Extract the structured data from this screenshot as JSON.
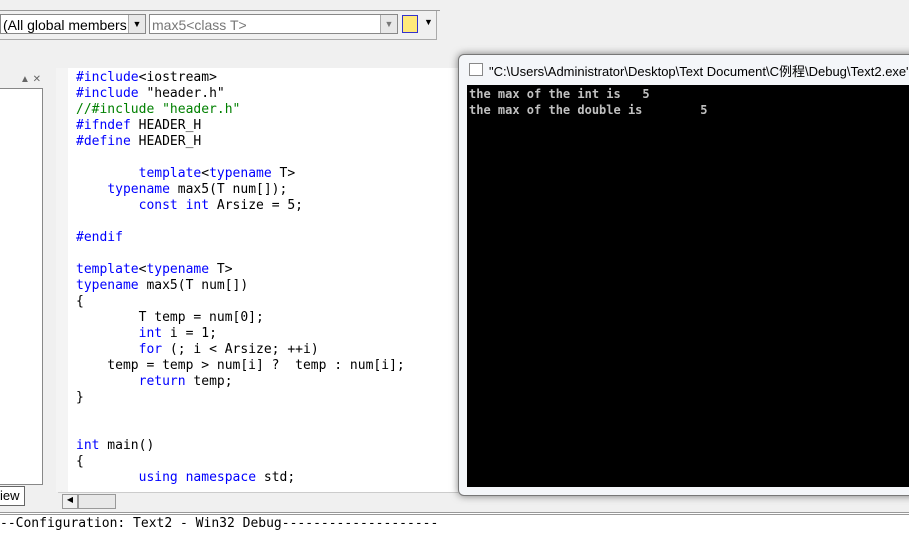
{
  "toolbar": {
    "scope_combo": "(All global members",
    "function_combo": "max5<class T>",
    "wizard_icon": "class-wizard-icon"
  },
  "left_panel": {
    "tab_label": "iew"
  },
  "code_lines": [
    [
      [
        "kw",
        "#include"
      ],
      [
        "",
        "<iostream>"
      ]
    ],
    [
      [
        "kw",
        "#include"
      ],
      [
        "",
        " \"header.h\""
      ]
    ],
    [
      [
        "cm",
        "//#include \"header.h\""
      ]
    ],
    [
      [
        "kw",
        "#ifndef"
      ],
      [
        "",
        " HEADER_H"
      ]
    ],
    [
      [
        "kw",
        "#define"
      ],
      [
        "",
        " HEADER_H"
      ]
    ],
    [],
    [
      [
        "",
        "        "
      ],
      [
        "kw",
        "template"
      ],
      [
        "",
        "<"
      ],
      [
        "kw",
        "typename"
      ],
      [
        "",
        " T>"
      ]
    ],
    [
      [
        "",
        "    "
      ],
      [
        "kw",
        "typename"
      ],
      [
        "",
        " max5(T num[]);"
      ]
    ],
    [
      [
        "",
        "        "
      ],
      [
        "kw",
        "const"
      ],
      [
        "",
        " "
      ],
      [
        "kw",
        "int"
      ],
      [
        "",
        " Arsize = 5;"
      ]
    ],
    [],
    [
      [
        "kw",
        "#endif"
      ]
    ],
    [],
    [
      [
        "kw",
        "template"
      ],
      [
        "",
        "<"
      ],
      [
        "kw",
        "typename"
      ],
      [
        "",
        " T>"
      ]
    ],
    [
      [
        "kw",
        "typename"
      ],
      [
        "",
        " max5(T num[])"
      ]
    ],
    [
      [
        "",
        "{"
      ]
    ],
    [
      [
        "",
        "        T temp = num[0];"
      ]
    ],
    [
      [
        "",
        "        "
      ],
      [
        "kw",
        "int"
      ],
      [
        "",
        " i = 1;"
      ]
    ],
    [
      [
        "",
        "        "
      ],
      [
        "kw",
        "for"
      ],
      [
        "",
        " (; i < Arsize; ++i)"
      ]
    ],
    [
      [
        "",
        "    temp = temp > num[i] ?  temp : num[i];"
      ]
    ],
    [
      [
        "",
        "        "
      ],
      [
        "kw",
        "return"
      ],
      [
        "",
        " temp;"
      ]
    ],
    [
      [
        "",
        "}"
      ]
    ],
    [],
    [],
    [
      [
        "kw",
        "int"
      ],
      [
        "",
        " main()"
      ]
    ],
    [
      [
        "",
        "{"
      ]
    ],
    [
      [
        "",
        "        "
      ],
      [
        "kw",
        "using"
      ],
      [
        "",
        " "
      ],
      [
        "kw",
        "namespace"
      ],
      [
        "",
        " std;"
      ]
    ]
  ],
  "console": {
    "title": "\"C:\\Users\\Administrator\\Desktop\\Text Document\\C例程\\Debug\\Text2.exe\"",
    "lines": [
      "the max of the int is   5",
      "the max of the double is        5"
    ]
  },
  "output": {
    "text": "--Configuration: Text2 - Win32 Debug--------------------"
  }
}
